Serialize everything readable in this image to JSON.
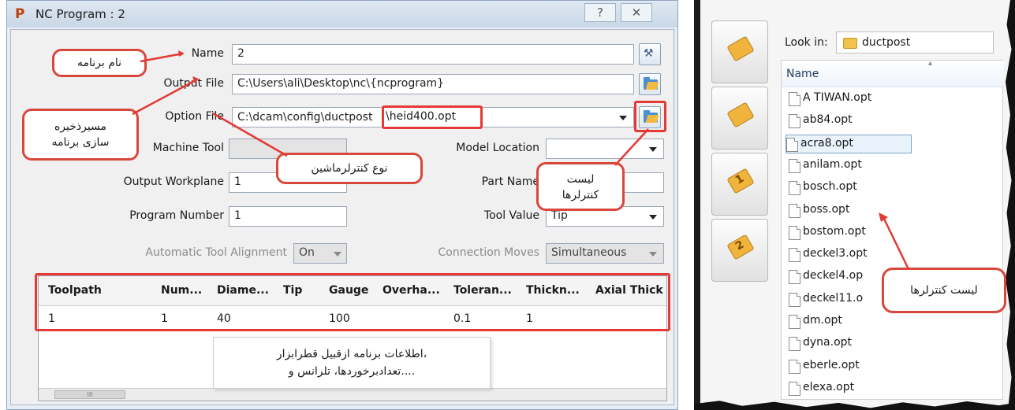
{
  "dialog": {
    "title": "NC Program : 2",
    "app_icon": "P",
    "help_glyph": "?",
    "close_glyph": "✕"
  },
  "form": {
    "name_label": "Name",
    "name_value": "2",
    "output_file_label": "Output File",
    "output_file_value": "C:\\Users\\ali\\Desktop\\nc\\{ncprogram}",
    "option_file_label": "Option File",
    "option_file_path_prefix": "C:\\dcam\\config\\ductpost",
    "option_file_name": "\\heid400.opt",
    "machine_tool_label": "Machine Tool",
    "model_location_label": "Model Location",
    "output_workplane_label": "Output Workplane",
    "output_workplane_value": "1",
    "part_name_label": "Part Name",
    "program_number_label": "Program Number",
    "program_number_value": "1",
    "tool_value_label": "Tool Value",
    "tool_value_value": "Tip",
    "auto_tool_alignment_label": "Automatic Tool Alignment",
    "auto_tool_alignment_value": "On",
    "connection_moves_label": "Connection Moves",
    "connection_moves_value": "Simultaneous"
  },
  "table": {
    "columns": [
      "Toolpath",
      "Num...",
      "Diame...",
      "Tip",
      "Gauge",
      "Overha...",
      "Toleran...",
      "Thickn...",
      "Axial Thick"
    ],
    "rows": [
      [
        "1",
        "1",
        "40",
        "",
        "100",
        "",
        "0.1",
        "1",
        ""
      ]
    ],
    "hscroll_glyph": "III"
  },
  "callouts": {
    "program_name": "نام برنامه",
    "save_path_line1": "مسیرذخیره",
    "save_path_line2": "سازی برنامه",
    "controller_type": "نوع کنترلرماشین",
    "controller_list_line1": "لیست",
    "controller_list_line2": "کنترلرها",
    "program_info_line1": "اطلاعات برنامه ازقبیل قطرابزار،",
    "program_info_line2": "تعدادبرخوردها، تلرانس و....",
    "right_controller_list": "لیست کنترلرها"
  },
  "file_browser": {
    "look_in_label": "Look in:",
    "folder": "ductpost",
    "name_header": "Name",
    "files": [
      "A TIWAN.opt",
      "ab84.opt",
      "acra8.opt",
      "anilam.opt",
      "bosch.opt",
      "boss.opt",
      "bostom.opt",
      "deckel3.opt",
      "deckel4.op",
      "deckel11.o",
      "dm.opt",
      "dyna.opt",
      "eberle.opt",
      "elexa.opt"
    ],
    "side_labels": [
      "1",
      "2"
    ]
  }
}
